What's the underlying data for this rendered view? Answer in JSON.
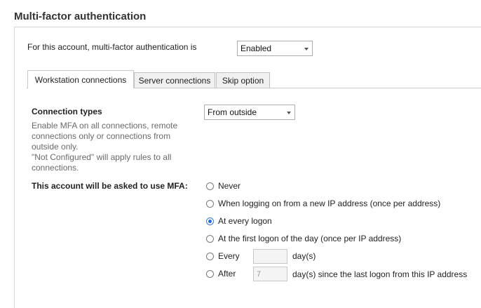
{
  "section": {
    "title": "Multi-factor authentication"
  },
  "account": {
    "label": "For this account, multi-factor authentication is",
    "status_value": "Enabled"
  },
  "tabs": [
    {
      "label": "Workstation connections",
      "active": true
    },
    {
      "label": "Server connections",
      "active": false
    },
    {
      "label": "Skip option",
      "active": false
    }
  ],
  "connection_types": {
    "label": "Connection types",
    "value": "From outside",
    "help": [
      "Enable MFA on all connections, remote",
      "connections only or connections from",
      "outside only.",
      "\"Not Configured\" will apply rules to all",
      "connections."
    ]
  },
  "mfa_frequency": {
    "label": "This account will be asked to use MFA:",
    "options": [
      {
        "label": "Never",
        "checked": false
      },
      {
        "label": "When logging on from a new IP address (once per address)",
        "checked": false
      },
      {
        "label": "At every logon",
        "checked": true
      },
      {
        "label": "At the first logon of the day (once per IP address)",
        "checked": false
      },
      {
        "label": "Every",
        "checked": false,
        "input_value": "",
        "suffix": "day(s)"
      },
      {
        "label": "After",
        "checked": false,
        "input_value": "7",
        "suffix": "day(s) since the last logon from this IP address"
      }
    ]
  },
  "colors": {
    "accent": "#1f6fd6",
    "border": "#abadb3",
    "help_text": "#6a6a6a"
  },
  "icons": {
    "dropdown": "chevron-down-icon"
  }
}
